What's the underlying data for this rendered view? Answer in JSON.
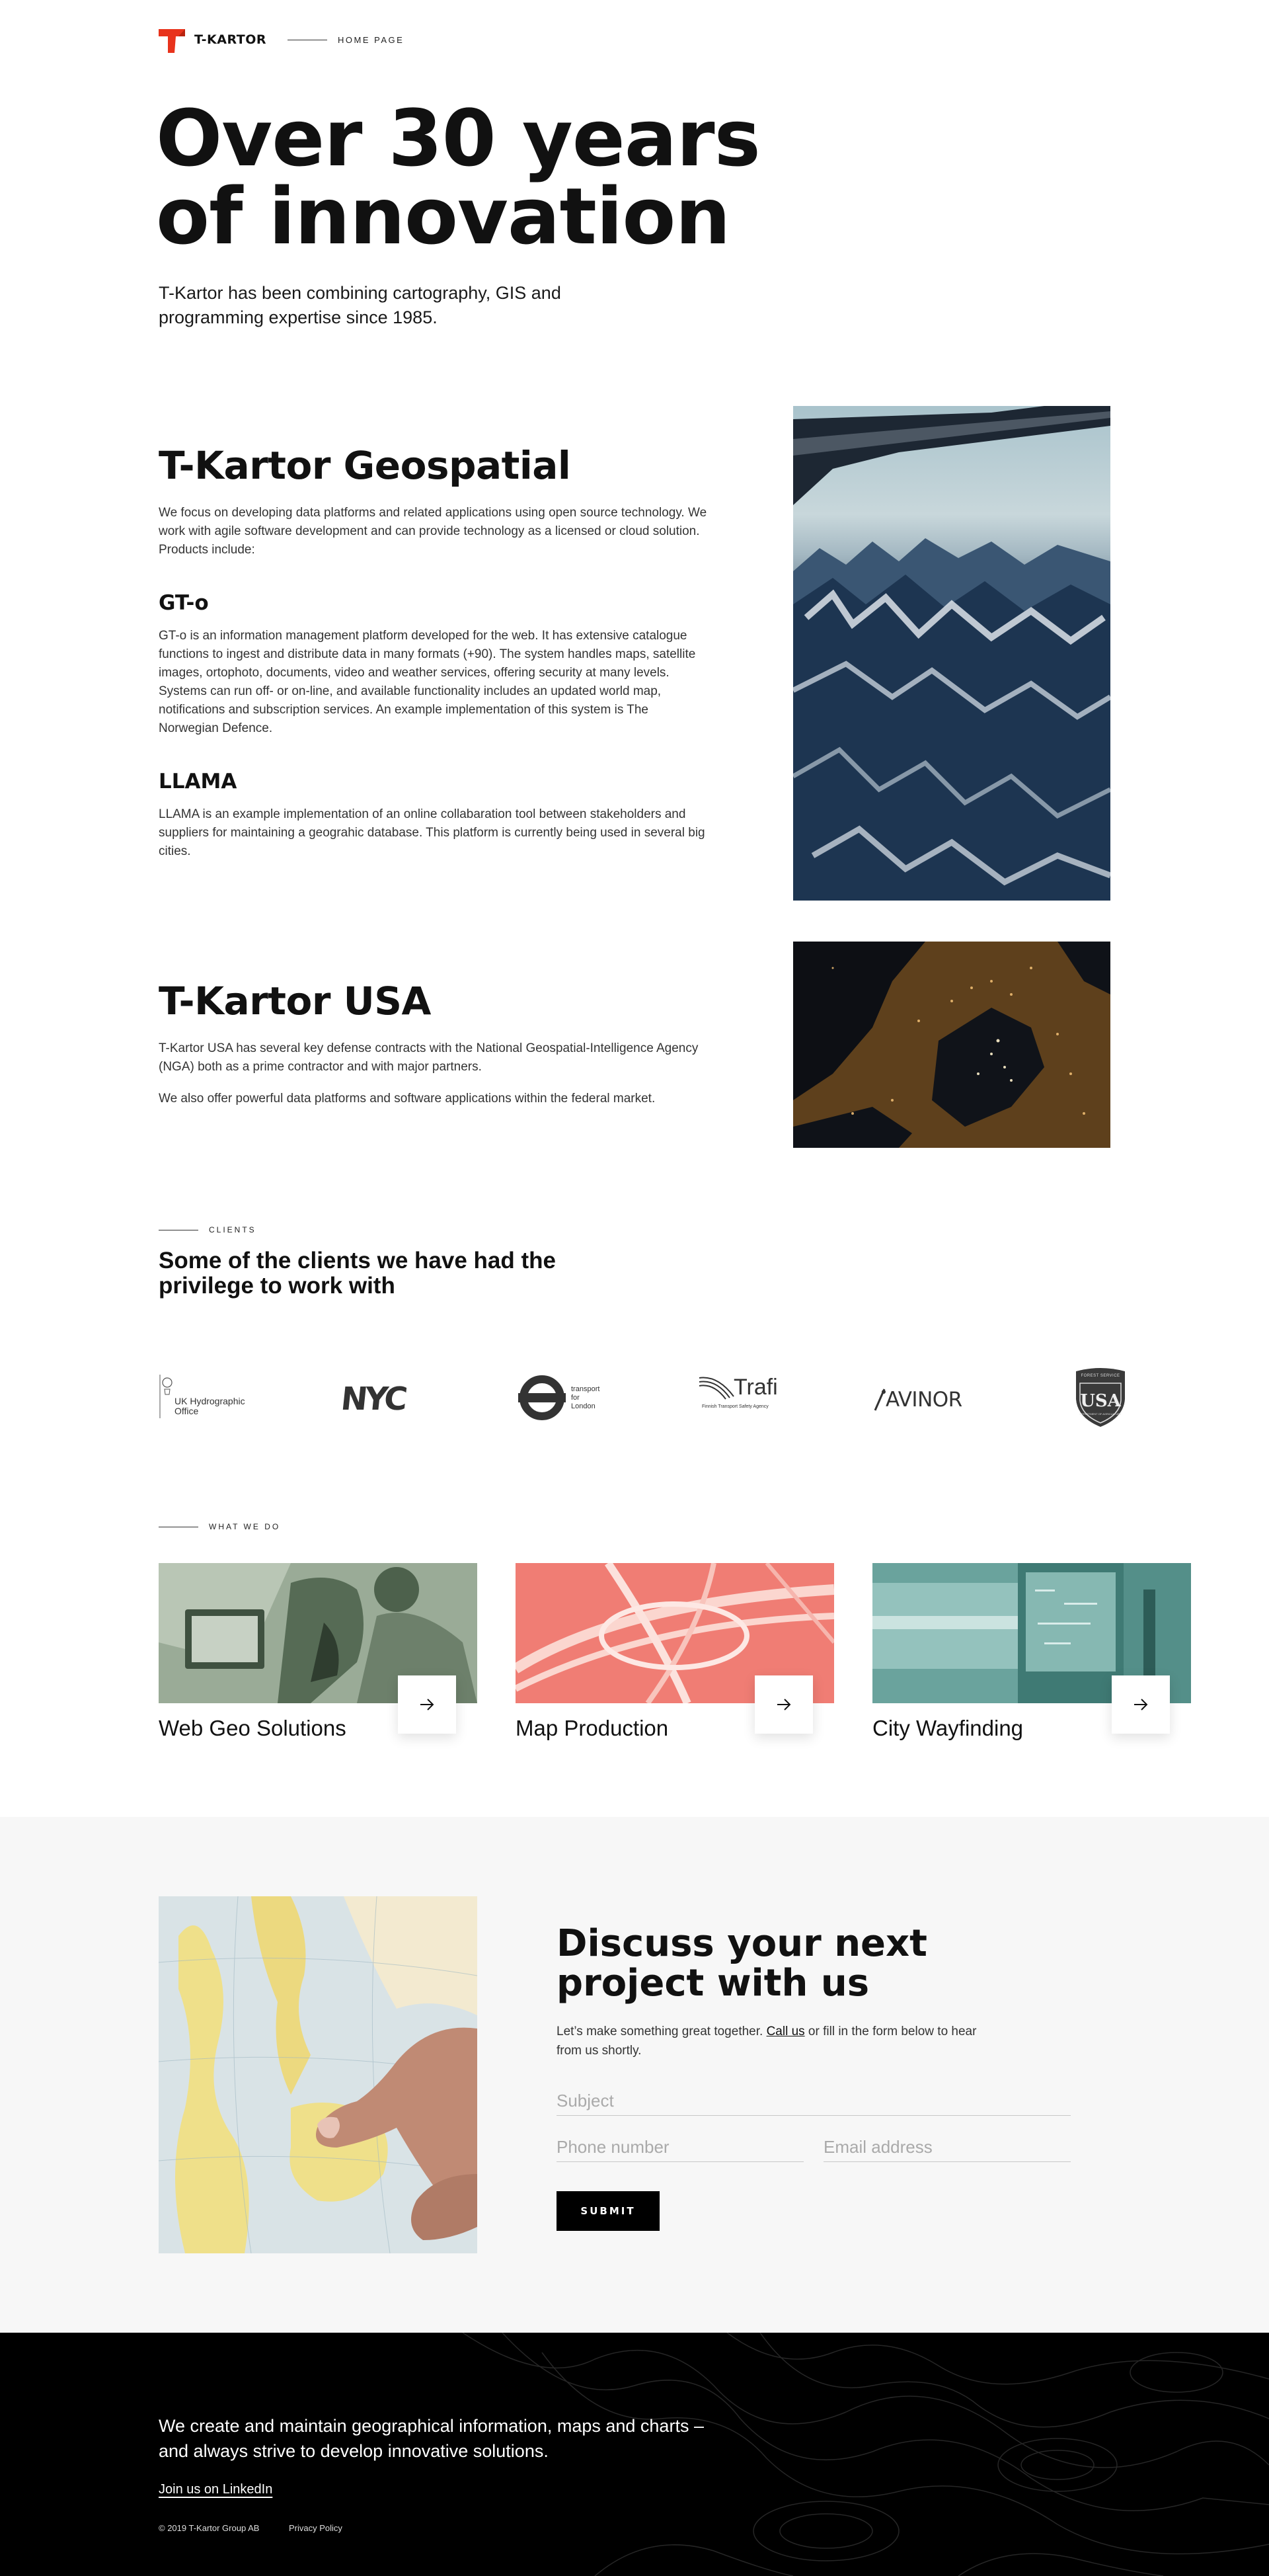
{
  "brand": {
    "name": "T-KARTOR",
    "accent": "#e8331c"
  },
  "header": {
    "nav_link": "HOME PAGE"
  },
  "hero": {
    "title_line1": "Over 30 years",
    "title_line2": "of innovation",
    "subtitle": "T-Kartor has been combining cartography, GIS and programming expertise since 1985."
  },
  "geospatial": {
    "title": "T-Kartor Geospatial",
    "intro": "We focus on developing data platforms and related applications using open source technology. We work with agile software development and can provide technology as a licensed or cloud solution. Products include:",
    "products": [
      {
        "name": "GT-o",
        "description": "GT-o is an information management platform developed for the web. It has extensive catalogue functions to ingest and distribute data in many formats (+90). The system handles maps, satellite images, ortophoto, documents, video and weather services, offering security at many levels. Systems can run off- or on-line, and available functionality includes an updated world map, notifications and subscription services. An example implementation of this system is The Norwegian Defence."
      },
      {
        "name": "LLAMA",
        "description": "LLAMA is an example implementation of an online collabaration tool between stakeholders and suppliers for maintaining a geograhic database. This platform is currently being used in several big cities."
      }
    ]
  },
  "usa": {
    "title": "T-Kartor USA",
    "paragraph1": "T-Kartor USA has several key defense contracts with the National Geospatial-Intelligence Agency (NGA) both as a prime contractor and with major partners.",
    "paragraph2": "We also offer powerful data platforms and software applications within the federal market."
  },
  "clients": {
    "eyebrow": "CLIENTS",
    "title": "Some of the clients we have had the privilege to work with",
    "logos": [
      {
        "name": "UK Hydrographic Office",
        "line1": "UK Hydrographic",
        "line2": "Office"
      },
      {
        "name": "NYC",
        "text": "NYC"
      },
      {
        "name": "Transport for London",
        "line1": "transport",
        "line2": "for",
        "line3": "London"
      },
      {
        "name": "Trafi",
        "text": "Trafi",
        "sub": "Finnish Transport Safety Agency"
      },
      {
        "name": "Avinor",
        "text": "AVINOR"
      },
      {
        "name": "US Forest Service",
        "top": "FOREST SERVICE",
        "text": "USA",
        "bottom": "DEPARTMENT OF AGRICULTURE"
      }
    ]
  },
  "services": {
    "eyebrow": "WHAT WE DO",
    "items": [
      {
        "title": "Web Geo Solutions",
        "tint": "#7a917a"
      },
      {
        "title": "Map Production",
        "tint": "#f27b73"
      },
      {
        "title": "City Wayfinding",
        "tint": "#5f9b95"
      }
    ]
  },
  "contact": {
    "title_line1": "Discuss your next",
    "title_line2": "project with us",
    "text_before": "Let’s make something great together. ",
    "call_link": "Call us",
    "text_after": " or fill in the form below to hear from us shortly.",
    "subject_placeholder": "Subject",
    "phone_placeholder": "Phone number",
    "email_placeholder": "Email address",
    "submit_label": "SUBMIT"
  },
  "footer": {
    "tagline": "We create and maintain geographical information, maps and charts – and always strive to develop innovative solutions.",
    "linkedin": "Join us on LinkedIn",
    "copyright": "© 2019 T-Kartor Group AB",
    "privacy": "Privacy Policy"
  }
}
